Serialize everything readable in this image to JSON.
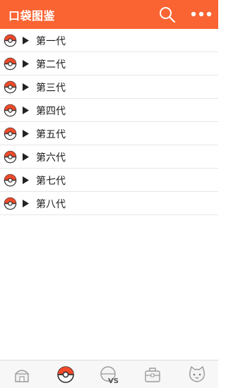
{
  "header": {
    "title": "口袋图鉴",
    "search_icon": "search-icon",
    "more_icon": "more-dots-icon",
    "background_color": "#fa6433"
  },
  "list": {
    "items": [
      {
        "label": "第一代",
        "icon": "pokeball-icon"
      },
      {
        "label": "第二代",
        "icon": "pokeball-icon"
      },
      {
        "label": "第三代",
        "icon": "pokeball-icon"
      },
      {
        "label": "第四代",
        "icon": "pokeball-icon"
      },
      {
        "label": "第五代",
        "icon": "pokeball-icon"
      },
      {
        "label": "第六代",
        "icon": "pokeball-icon"
      },
      {
        "label": "第七代",
        "icon": "pokeball-icon"
      },
      {
        "label": "第八代",
        "icon": "pokeball-icon"
      }
    ]
  },
  "bottom_nav": {
    "items": [
      {
        "icon": "home-icon",
        "active": false
      },
      {
        "icon": "pokeball-icon",
        "active": true
      },
      {
        "icon": "versus-icon",
        "active": false,
        "text": "VS"
      },
      {
        "icon": "bag-icon",
        "active": false
      },
      {
        "icon": "cat-face-icon",
        "active": false
      }
    ]
  }
}
